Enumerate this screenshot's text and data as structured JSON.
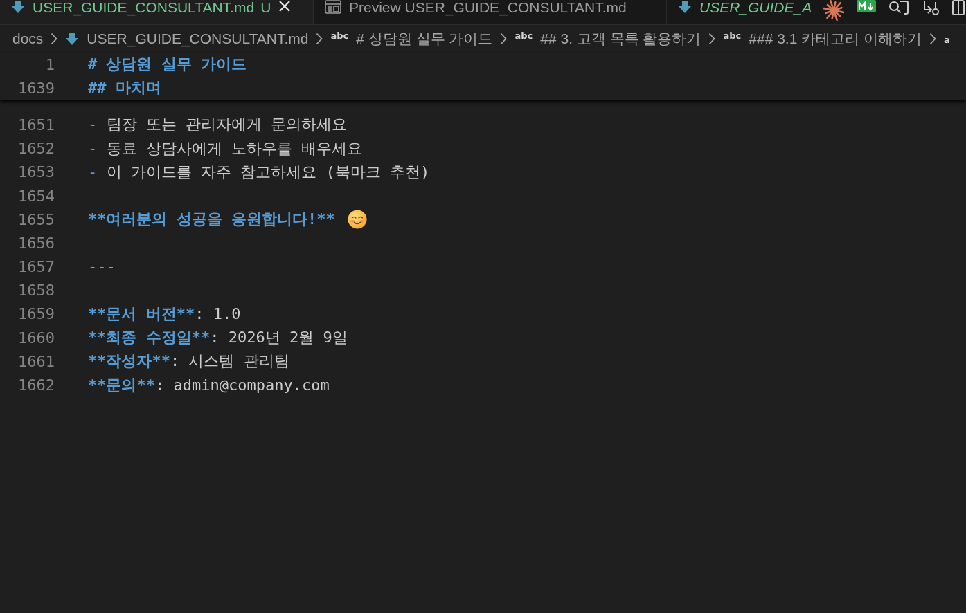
{
  "tabs": [
    {
      "kind": "file",
      "label": "USER_GUIDE_CONSULTANT.md",
      "status": "U",
      "selected": true,
      "preview": false
    },
    {
      "kind": "preview",
      "label": "Preview USER_GUIDE_CONSULTANT.md",
      "selected": false,
      "preview": false
    },
    {
      "kind": "file",
      "label": "USER_GUIDE_A",
      "selected": false,
      "preview": true
    }
  ],
  "breadcrumbs": [
    {
      "kind": "folder",
      "label": "docs"
    },
    {
      "kind": "file",
      "label": "USER_GUIDE_CONSULTANT.md"
    },
    {
      "kind": "symbol",
      "symbol": "abc",
      "label": "# 상담원 실무 가이드"
    },
    {
      "kind": "symbol",
      "symbol": "abc",
      "label": "## 3. 고객 목록 활용하기"
    },
    {
      "kind": "symbol",
      "symbol": "abc",
      "label": "### 3.1 카테고리 이해하기"
    },
    {
      "kind": "symbol",
      "symbol": "a"
    }
  ],
  "sticky_lines": [
    {
      "number": "1",
      "segments": [
        {
          "kind": "heading",
          "text": "# 상담원 실무 가이드"
        }
      ]
    },
    {
      "number": "1639",
      "segments": [
        {
          "kind": "heading",
          "text": "## 마치며"
        }
      ]
    }
  ],
  "lines": [
    {
      "number": "1651",
      "segments": [
        {
          "kind": "marker",
          "text": "- "
        },
        {
          "kind": "plain",
          "text": "팀장 또는 관리자에게 문의하세요"
        }
      ]
    },
    {
      "number": "1652",
      "segments": [
        {
          "kind": "marker",
          "text": "- "
        },
        {
          "kind": "plain",
          "text": "동료 상담사에게 노하우를 배우세요"
        }
      ]
    },
    {
      "number": "1653",
      "segments": [
        {
          "kind": "marker",
          "text": "- "
        },
        {
          "kind": "plain",
          "text": "이 가이드를 자주 참고하세요 (북마크 추천)"
        }
      ]
    },
    {
      "number": "1654"
    },
    {
      "number": "1655",
      "segments": [
        {
          "kind": "bold",
          "text": "**여러분의 성공을 응원합니다!**"
        },
        {
          "kind": "emoji"
        }
      ]
    },
    {
      "number": "1656"
    },
    {
      "number": "1657",
      "segments": [
        {
          "kind": "plain",
          "text": "---"
        }
      ]
    },
    {
      "number": "1658"
    },
    {
      "number": "1659",
      "segments": [
        {
          "kind": "bold",
          "text": "**문서 버전**"
        },
        {
          "kind": "plain",
          "text": ": 1.0"
        }
      ]
    },
    {
      "number": "1660",
      "segments": [
        {
          "kind": "bold",
          "text": "**최종 수정일**"
        },
        {
          "kind": "plain",
          "text": ": 2026년 2월 9일"
        }
      ]
    },
    {
      "number": "1661",
      "segments": [
        {
          "kind": "bold",
          "text": "**작성자**"
        },
        {
          "kind": "plain",
          "text": ": 시스템 관리팀"
        }
      ]
    },
    {
      "number": "1662",
      "segments": [
        {
          "kind": "bold",
          "text": "**문의**"
        },
        {
          "kind": "plain",
          "text": ": admin@company.com"
        }
      ]
    }
  ]
}
